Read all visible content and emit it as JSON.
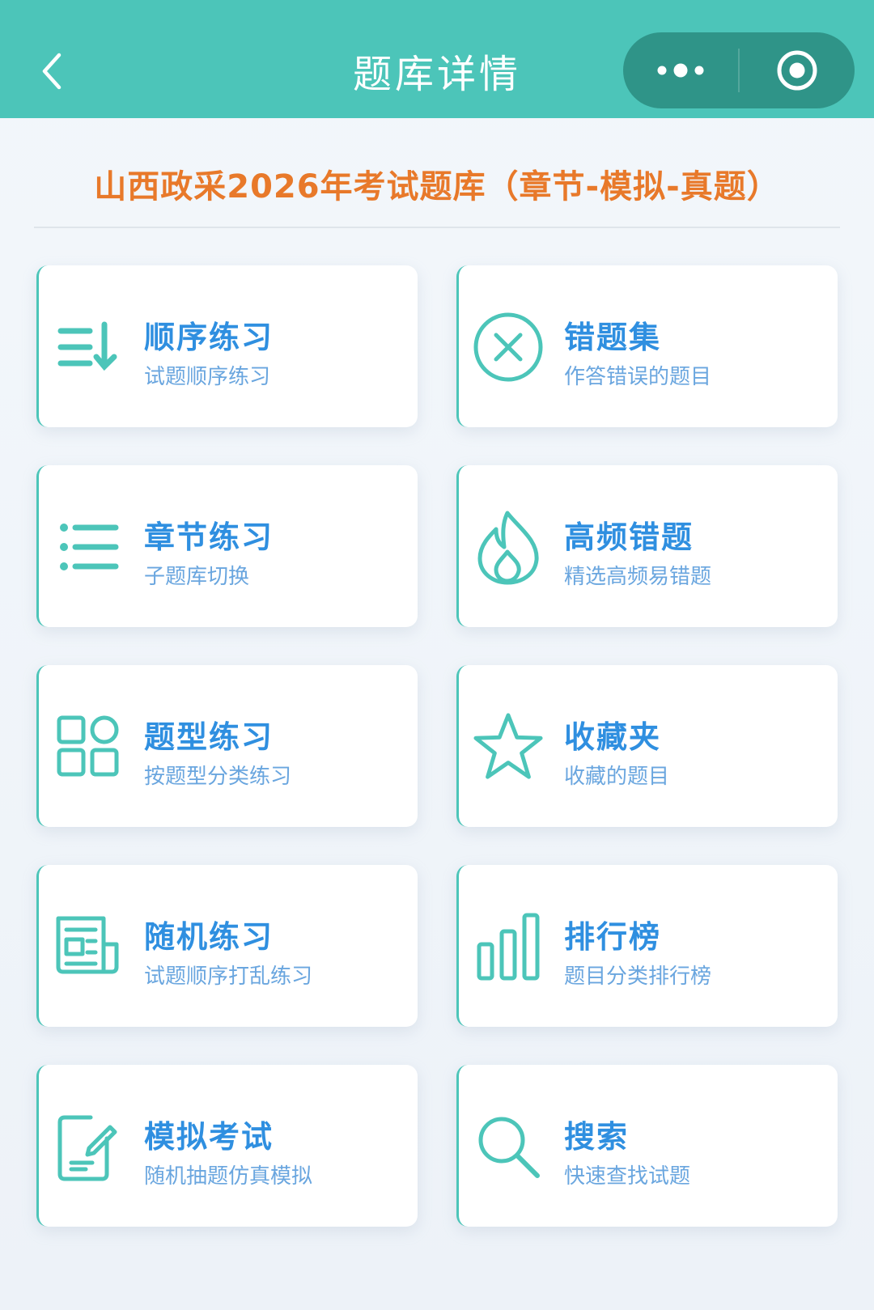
{
  "nav": {
    "title": "题库详情",
    "back_icon": "chevron-left-icon",
    "more_icon": "more-dots-icon",
    "close_icon": "record-circle-icon",
    "bg_color": "#4cc5b9",
    "capsule_color": "#2f9488"
  },
  "bank": {
    "title": "山西政采2026年考试题库（章节-模拟-真题）",
    "title_color": "#e8792a"
  },
  "colors": {
    "accent": "#4cc5b9",
    "card_title": "#2f8fe0",
    "card_sub": "#6aa6df"
  },
  "cards": [
    {
      "title": "顺序练习",
      "subtitle": "试题顺序练习",
      "icon": "sort-list-icon"
    },
    {
      "title": "错题集",
      "subtitle": "作答错误的题目",
      "icon": "close-circle-icon"
    },
    {
      "title": "章节练习",
      "subtitle": "子题库切换",
      "icon": "list-icon"
    },
    {
      "title": "高频错题",
      "subtitle": "精选高频易错题",
      "icon": "flame-icon"
    },
    {
      "title": "题型练习",
      "subtitle": "按题型分类练习",
      "icon": "grid-apps-icon"
    },
    {
      "title": "收藏夹",
      "subtitle": "收藏的题目",
      "icon": "star-icon"
    },
    {
      "title": "随机练习",
      "subtitle": "试题顺序打乱练习",
      "icon": "newspaper-icon"
    },
    {
      "title": "排行榜",
      "subtitle": "题目分类排行榜",
      "icon": "bar-chart-icon"
    },
    {
      "title": "模拟考试",
      "subtitle": "随机抽题仿真模拟",
      "icon": "edit-document-icon"
    },
    {
      "title": "搜索",
      "subtitle": "快速查找试题",
      "icon": "search-icon"
    }
  ]
}
